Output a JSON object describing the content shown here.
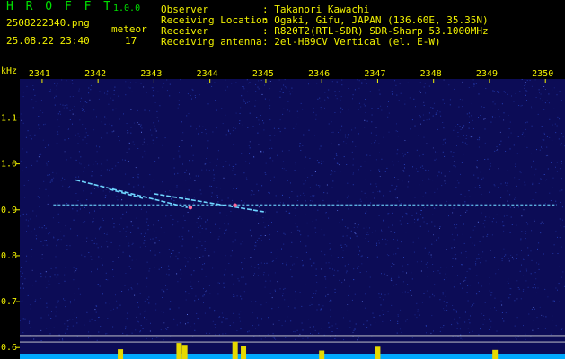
{
  "header": {
    "app_name": "H R O F F T",
    "version": "1.0.0",
    "file_name": "2508222340.png",
    "datetime": "25.08.22 23:40",
    "detection_label": "meteor",
    "detection_count": "17",
    "meta": [
      {
        "key": "Observer",
        "value": ": Takanori Kawachi"
      },
      {
        "key": "Receiving Location",
        "value": ": Ogaki, Gifu, JAPAN (136.60E, 35.35N)"
      },
      {
        "key": "Receiver",
        "value": ": R820T2(RTL-SDR) SDR-Sharp 53.1000MHz"
      },
      {
        "key": "Receiving antenna",
        "value": ": 2el-HB9CV Vertical (el. E-W)"
      }
    ]
  },
  "colors": {
    "background_panel": "#0c0c56",
    "noise": "#2b49c8",
    "signal": "#6fd6ff",
    "echo_hot": "#ff6a9a",
    "text_yellow": "#f2f200",
    "text_green": "#00e000",
    "reference_line": "#d8d8d8",
    "activity": "#e6d800",
    "activity_base": "#00aaff"
  },
  "chart_data": {
    "type": "heatmap",
    "ylabel": "kHz",
    "x_ticks": [
      "2341",
      "2342",
      "2343",
      "2344",
      "2345",
      "2346",
      "2347",
      "2348",
      "2349",
      "2350"
    ],
    "x_range": [
      2340.6,
      2350.35
    ],
    "y_ticks": [
      "1.1",
      "1.0",
      "0.9",
      "0.8",
      "0.7",
      "0.6"
    ],
    "y_range": [
      0.575,
      1.185
    ],
    "carrier": {
      "freq_khz": 0.91,
      "x_start": 2341.2,
      "x_end": 2350.2
    },
    "echoes": [
      {
        "x": [
          2341.6,
          2343.6
        ],
        "y": [
          0.965,
          0.905
        ]
      },
      {
        "x": [
          2343.0,
          2345.0
        ],
        "y": [
          0.935,
          0.895
        ]
      },
      {
        "x": [
          2342.2,
          2342.8
        ],
        "y": [
          0.945,
          0.925
        ]
      }
    ],
    "reference_lines_khz": [
      0.626,
      0.612
    ],
    "activity_bursts": [
      {
        "x": 2343.45,
        "level": 0.85
      },
      {
        "x": 2343.55,
        "level": 0.7
      },
      {
        "x": 2344.45,
        "level": 0.95
      },
      {
        "x": 2344.6,
        "level": 0.6
      },
      {
        "x": 2347.0,
        "level": 0.55
      },
      {
        "x": 2342.4,
        "level": 0.35
      },
      {
        "x": 2346.0,
        "level": 0.25
      },
      {
        "x": 2349.1,
        "level": 0.3
      }
    ]
  }
}
